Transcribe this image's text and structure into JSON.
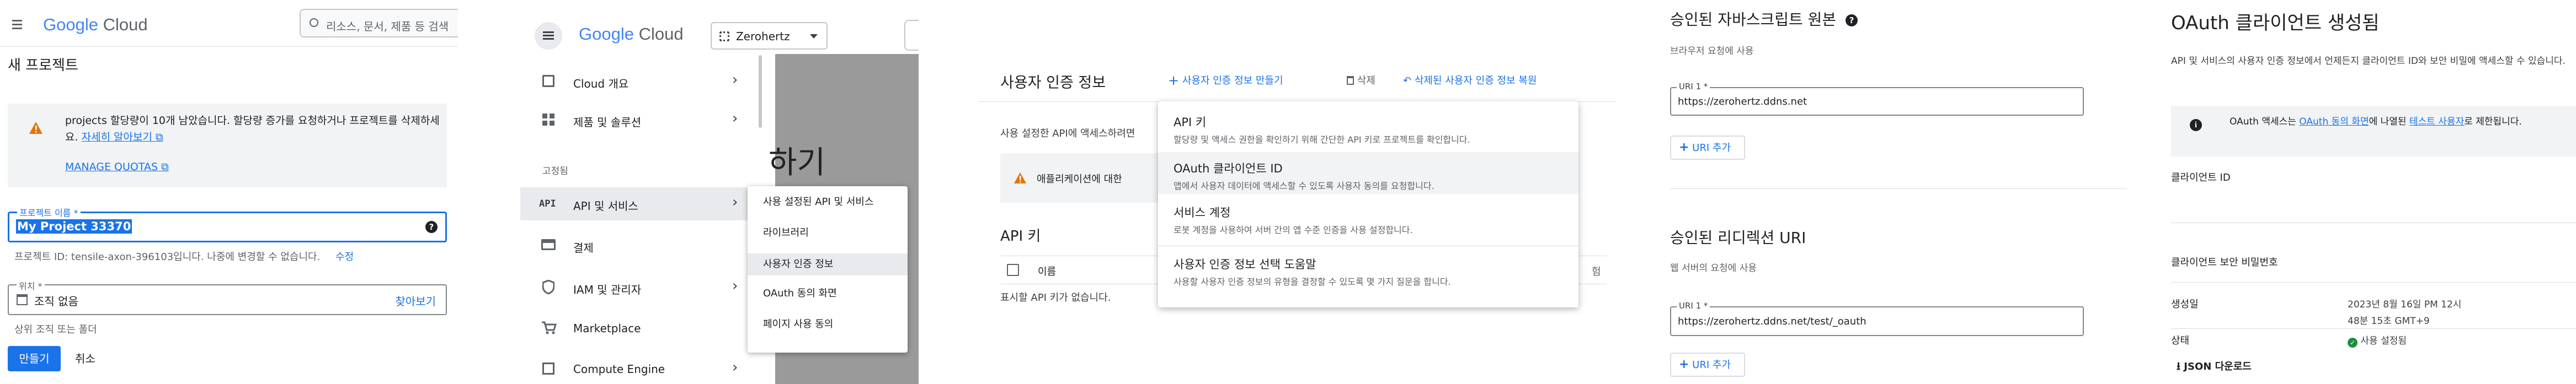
{
  "p1": {
    "logo": {
      "g": "Google",
      "c": "Cloud"
    },
    "search_placeholder": "리소스, 문서, 제품 등 검색",
    "page_title": "새 프로젝트",
    "alert": {
      "text": "projects 할당량이 10개 남았습니다. 할당량 증가를 요청하거나 프로젝트를 삭제하세요.",
      "learn_more": "자세히 알아보기",
      "manage_quotas": "MANAGE QUOTAS"
    },
    "project_name": {
      "label": "프로젝트 이름 *",
      "value": "My Project 33370"
    },
    "project_id": {
      "text": "프로젝트 ID: tensile-axon-396103입니다. 나중에 변경할 수 없습니다.",
      "edit": "수정"
    },
    "location": {
      "label": "위치 *",
      "value": "조직 없음",
      "browse": "찾아보기",
      "hint": "상위 조직 또는 폴더"
    },
    "create": "만들기",
    "cancel": "취소"
  },
  "p2": {
    "logo": {
      "g": "Google",
      "c": "Cloud"
    },
    "project_selector": "Zerohertz",
    "nav": [
      "Cloud 개요",
      "제품 및 솔루션"
    ],
    "pinned_label": "고정됨",
    "pinned": [
      "API 및 서비스",
      "결제",
      "IAM 및 관리자",
      "Marketplace",
      "Compute Engine"
    ],
    "bg_heading": "하기",
    "submenu": [
      "사용 설정된 API 및 서비스",
      "라이브러리",
      "사용자 인증 정보",
      "OAuth 동의 화면",
      "페이지 사용 동의"
    ]
  },
  "p3": {
    "title": "사용자 인증 정보",
    "create": "사용자 인증 정보 만들기",
    "delete": "삭제",
    "restore": "삭제된 사용자 인증 정보 복원",
    "desc": "사용 설정한 API에 액세스하려면",
    "warn": "애플리케이션에 대한",
    "api_keys": "API 키",
    "col_name": "이름",
    "empty": "표시할 API 키가 없습니다.",
    "menu": [
      {
        "title": "API 키",
        "desc": "할당량 및 액세스 권한을 확인하기 위해 간단한 API 키로 프로젝트를 확인합니다."
      },
      {
        "title": "OAuth 클라이언트 ID",
        "desc": "앱에서 사용자 데이터에 액세스할 수 있도록 사용자 동의를 요청합니다."
      },
      {
        "title": "서비스 계정",
        "desc": "로봇 계정을 사용하여 서버 간의 앱 수준 인증을 사용 설정합니다."
      },
      {
        "title": "사용자 인증 정보 선택 도움말",
        "desc": "사용할 사용자 인증 정보의 유형을 결정할 수 있도록 몇 가지 질문을 합니다."
      }
    ]
  },
  "p4": {
    "origins": {
      "title": "승인된 자바스크립트 원본",
      "desc": "브라우저 요청에 사용",
      "label": "URI 1 *",
      "value": "https://zerohertz.ddns.net",
      "add": "URI 추가"
    },
    "redirects": {
      "title": "승인된 리디렉션 URI",
      "desc": "웹 서버의 요청에 사용",
      "label": "URI 1 *",
      "value": "https://zerohertz.ddns.net/test/_oauth",
      "add": "URI 추가"
    }
  },
  "p5": {
    "title": "OAuth 클라이언트 생성됨",
    "desc": "API 및 서비스의 사용자 인증 정보에서 언제든지 클라이언트 ID와 보안 비밀에 액세스할 수 있습니다.",
    "info": {
      "pre": "OAuth 액세스는 ",
      "link1": "OAuth 동의 화면",
      "mid": "에 나열된 ",
      "link2": "테스트 사용자",
      "post": "로 제한됩니다."
    },
    "client_id_label": "클라이언트 ID",
    "secret_label": "클라이언트 보안 비밀번호",
    "created_label": "생성일",
    "created_value": "2023년 8월 16일 PM 12시 48분 15초 GMT+9",
    "status_label": "상태",
    "status_value": "사용 설정됨",
    "download": "JSON 다운로드"
  }
}
